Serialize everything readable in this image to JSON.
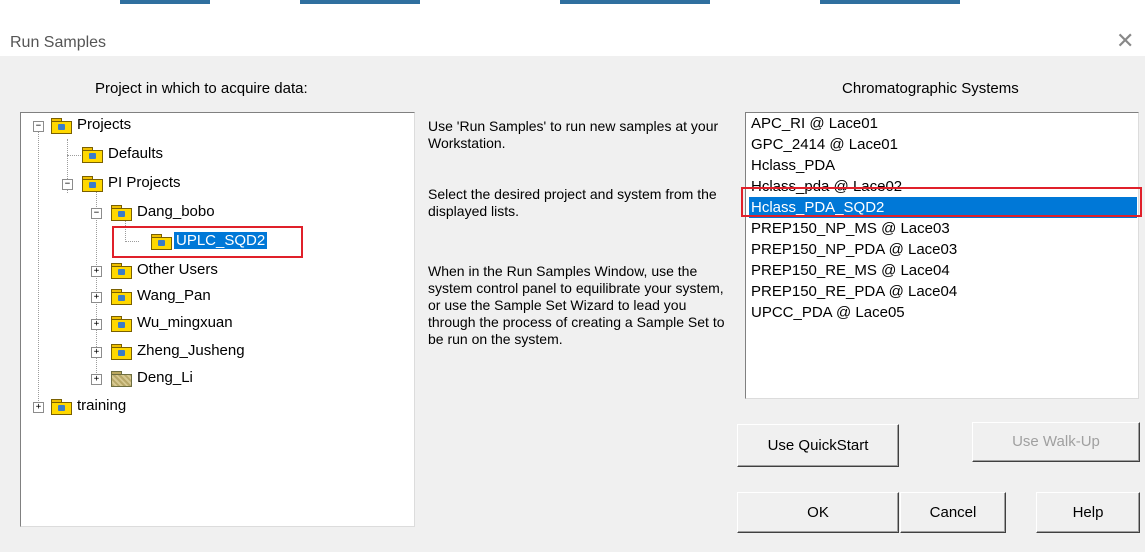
{
  "window": {
    "title": "Run Samples",
    "close_glyph": "✕"
  },
  "labels": {
    "project_heading": "Project in which to acquire data:",
    "systems_heading": "Chromatographic Systems"
  },
  "tree": {
    "projects": "Projects",
    "defaults": "Defaults",
    "pi_projects": "PI Projects",
    "dang_bobo": "Dang_bobo",
    "uplc_sqd2": "UPLC_SQD2",
    "other_users": "Other Users",
    "wang_pan": "Wang_Pan",
    "wu_mingxuan": "Wu_mingxuan",
    "zheng_jusheng": "Zheng_Jusheng",
    "deng_li": "Deng_Li",
    "training": "training",
    "expand_glyph": "+",
    "collapse_glyph": "−"
  },
  "description": {
    "p1": "Use 'Run Samples' to run new samples at your Workstation.",
    "p2": "Select the desired project and system from the displayed lists.",
    "p3": "When in the Run Samples Window, use the system control panel to equilibrate your system, or use the Sample Set Wizard to lead you through the process of creating a Sample Set to be run on the system."
  },
  "systems": {
    "items": [
      "APC_RI @ Lace01",
      "GPC_2414 @ Lace01",
      "Hclass_PDA",
      "Hclass_pda @ Lace02",
      "Hclass_PDA_SQD2",
      "PREP150_NP_MS @ Lace03",
      "PREP150_NP_PDA @ Lace03",
      "PREP150_RE_MS @ Lace04",
      "PREP150_RE_PDA @ Lace04",
      "UPCC_PDA @ Lace05"
    ],
    "selected": "Hclass_PDA_SQD2"
  },
  "buttons": {
    "quickstart": "Use QuickStart",
    "walkup": "Use Walk-Up",
    "ok": "OK",
    "cancel": "Cancel",
    "help": "Help"
  },
  "colors": {
    "selection": "#0078d7",
    "highlight_box": "#e0202a",
    "dialog_bg": "#f0f0f0"
  }
}
